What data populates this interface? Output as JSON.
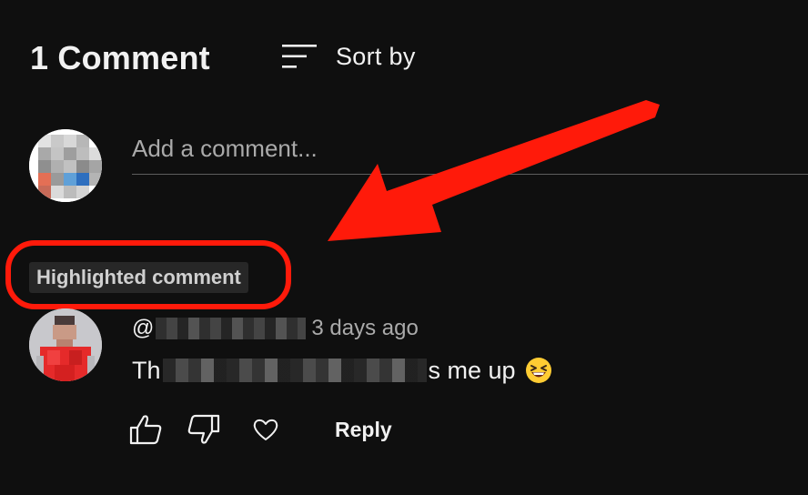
{
  "header": {
    "comment_count": "1 Comment",
    "sort_label": "Sort by"
  },
  "composer": {
    "placeholder": "Add a comment..."
  },
  "highlight": {
    "badge": "Highlighted comment",
    "annotation_color": "#ff1a0a"
  },
  "comment": {
    "author": "@",
    "timestamp": "3 days ago",
    "text_start": "Th",
    "text_end": "s me up",
    "emoji": "grinning-squinting-face-emoji",
    "actions": {
      "reply_label": "Reply",
      "like_icon": "thumbs-up-icon",
      "dislike_icon": "thumbs-down-icon",
      "heart_icon": "heart-icon"
    }
  },
  "colors": {
    "background": "#0f0f0f",
    "text": "#f1f1f1",
    "muted_text": "#aaaaaa"
  }
}
